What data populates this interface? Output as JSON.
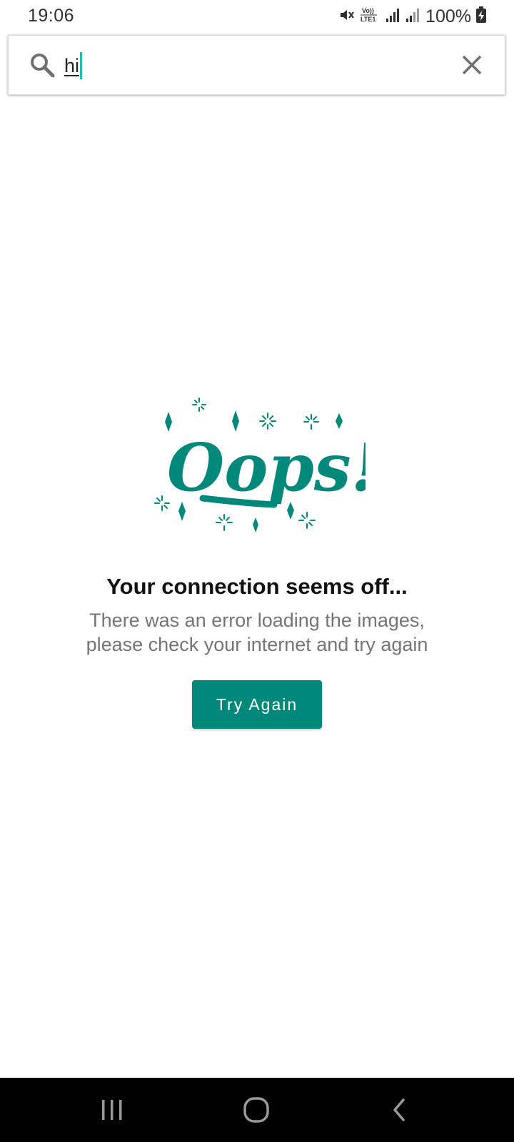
{
  "status_bar": {
    "time": "19:06",
    "battery_percent": "100%",
    "icons": [
      "mute-icon",
      "volte-icon",
      "signal-icon",
      "signal-icon",
      "battery-charging-icon"
    ]
  },
  "search": {
    "query": "hi",
    "icons": [
      "search-icon",
      "close-icon"
    ]
  },
  "error": {
    "illustration_text": "Oops!",
    "title": "Your connection seems off...",
    "message": "There was an error loading the images, please check your internet and try again",
    "button_label": "Try Again"
  },
  "nav_bar": {
    "icons": [
      "recent-apps-icon",
      "home-icon",
      "back-icon"
    ]
  },
  "colors": {
    "accent": "#00897b",
    "caret": "#1fbfb0",
    "title": "#111111",
    "message": "#757575"
  }
}
